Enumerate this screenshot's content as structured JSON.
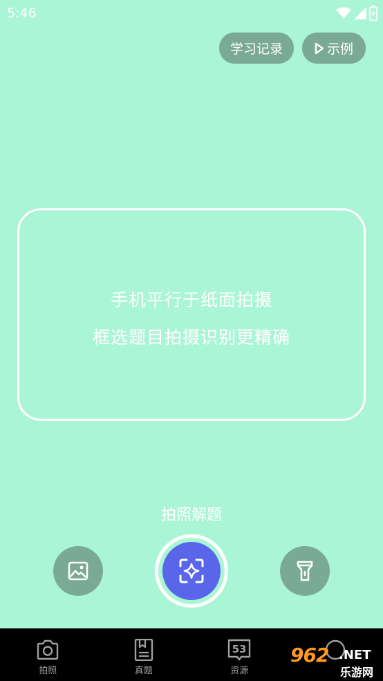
{
  "status_bar": {
    "time": "5:46",
    "icons": [
      "wifi-icon",
      "signal-icon",
      "battery-charging-icon"
    ]
  },
  "top_actions": {
    "history_label": "学习记录",
    "example_label": "示例",
    "example_icon": "play-icon"
  },
  "scan_frame": {
    "hint_line1": "手机平行于纸面拍摄",
    "hint_line2": "框选题目拍摄识别更精确"
  },
  "mode_label": "拍照解题",
  "controls": {
    "gallery_icon": "image-icon",
    "shutter_icon": "scan-sparkle-icon",
    "torch_icon": "flashlight-icon"
  },
  "bottom_nav": {
    "items": [
      {
        "label": "拍照",
        "icon": "camera-icon"
      },
      {
        "label": "真题",
        "icon": "document-icon"
      },
      {
        "label": "资源",
        "icon": "book-53-icon",
        "badge": "53"
      },
      {
        "label": "",
        "icon": "profile-icon"
      }
    ]
  },
  "watermark": {
    "brand": "962",
    "suffix": ".NET",
    "sub": "乐游网"
  },
  "colors": {
    "background": "#abf5d7",
    "button_fill": "#7aa996",
    "shutter": "#5a66ea",
    "nav_bg": "#000000"
  }
}
